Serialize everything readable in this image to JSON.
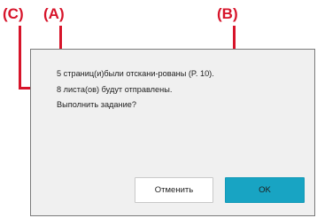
{
  "callouts": {
    "a": "(A)",
    "b": "(B)",
    "c": "(C)"
  },
  "dialog": {
    "lines": [
      "5 страниц(и)были отскани-рованы (P. 10).",
      "8 листа(ов) будут отправлены.",
      "Выполнить задание?"
    ],
    "cancel_label": "Отменить",
    "ok_label": "OK"
  },
  "colors": {
    "callout": "#d7142a",
    "ok_button": "#18a4c3",
    "dialog_bg": "#f0f0f0",
    "dialog_border": "#7b7b7b"
  }
}
